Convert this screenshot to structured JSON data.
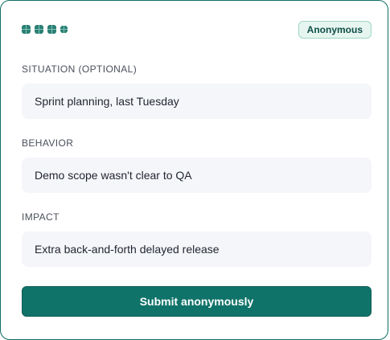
{
  "header": {
    "progress_dots": [
      "step-1",
      "step-2",
      "step-3",
      "step-4"
    ],
    "badge": "Anonymous"
  },
  "form": {
    "fields": [
      {
        "label": "SITUATION (OPTIONAL)",
        "value": "Sprint planning, last Tuesday"
      },
      {
        "label": "BEHAVIOR",
        "value": "Demo scope wasn't clear to QA"
      },
      {
        "label": "IMPACT",
        "value": "Extra back-and-forth delayed release"
      }
    ],
    "submit_label": "Submit anonymously"
  },
  "colors": {
    "accent": "#10736a",
    "badge_bg": "#e6f5ef",
    "field_bg": "#f5f6f9"
  }
}
